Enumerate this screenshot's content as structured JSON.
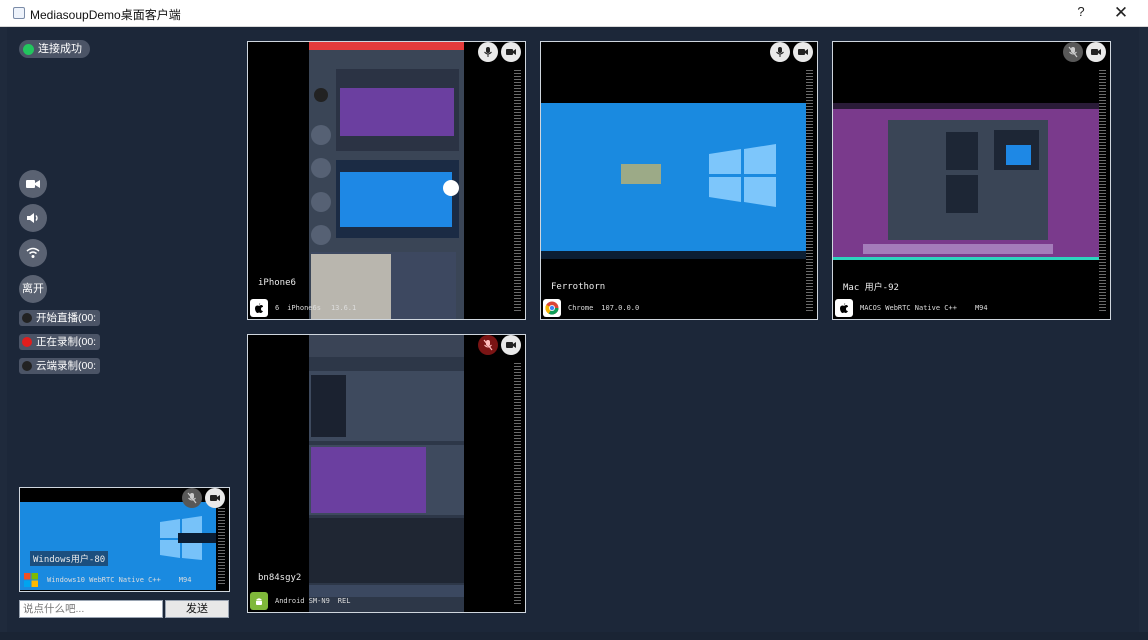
{
  "window": {
    "title": "MediasoupDemo桌面客户端",
    "help": "?",
    "close": "✕"
  },
  "status": {
    "label": "连接成功",
    "color": "#22c55e"
  },
  "controls": {
    "camera": "camera-icon",
    "speaker": "speaker-icon",
    "wifi": "wifi-icon",
    "leave_label": "离开"
  },
  "recording": [
    {
      "label": "开始直播(00:",
      "color": "#222222"
    },
    {
      "label": "正在录制(00:",
      "color": "#e11d1d"
    },
    {
      "label": "云端录制(00:",
      "color": "#222222"
    }
  ],
  "tiles": [
    {
      "name": "iPhone6",
      "os": "",
      "ver": "iPhone6s",
      "extra": "13.6.1",
      "os_label": "6"
    },
    {
      "name": "Ferrothorn",
      "os": "Chrome",
      "ver": "107.0.0.0"
    },
    {
      "name": "Mac 用户-92",
      "os": "MACOS WebRTC Native C++",
      "ver": "M94"
    },
    {
      "name": "bn84sgy2",
      "os": "Android SM-N9",
      "ver": "REL"
    }
  ],
  "self_view": {
    "name": "Windows用户-80",
    "os": "Windows10 WebRTC Native C++",
    "ver": "M94"
  },
  "chat": {
    "placeholder": "说点什么吧...",
    "send_label": "发送"
  },
  "colors": {
    "bg": "#1c2739",
    "accent_teal": "#2dd4bf"
  }
}
